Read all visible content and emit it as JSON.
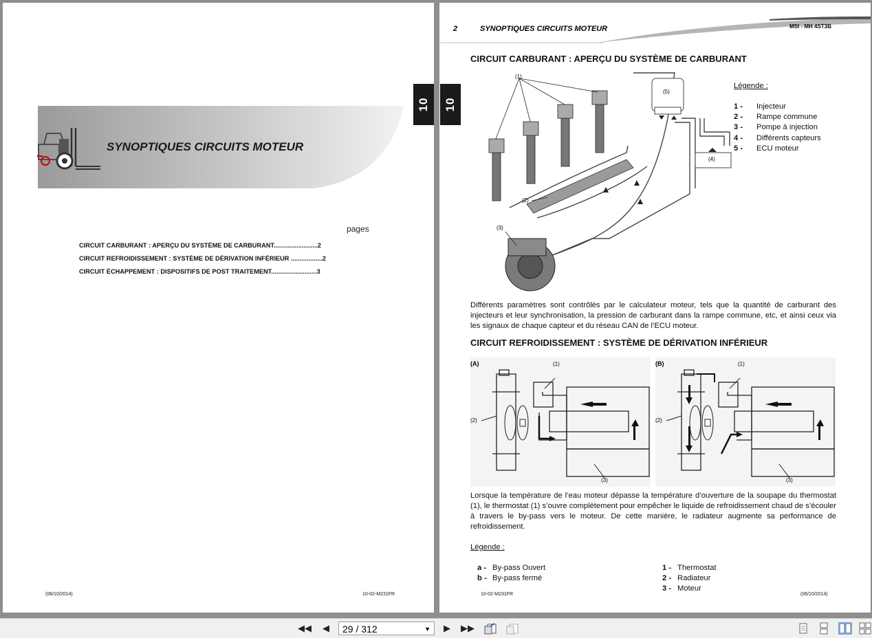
{
  "left_page": {
    "tab_number": "10",
    "cover_title": "SYNOPTIQUES CIRCUITS MOTEUR",
    "pages_label": "pages",
    "toc": [
      {
        "title": "CIRCUIT CARBURANT : APERÇU DU SYSTÈME DE CARBURANT",
        "page": "2"
      },
      {
        "title": "CIRCUIT REFROIDISSEMENT : SYSTÈME DE DÉRIVATION INFÉRIEUR",
        "page": "2"
      },
      {
        "title": "CIRCUIT ÉCHAPPEMENT : DISPOSITIFS DE POST TRAITEMENT",
        "page": "3"
      }
    ],
    "footer_date": "(06/10/2014)",
    "footer_ref": "10-02-M231FR"
  },
  "right_page": {
    "tab_number": "10",
    "header_page": "2",
    "header_title": "SYNOPTIQUES CIRCUITS MOTEUR",
    "header_ref": "MSI - MH 4ST3B",
    "section1_title": "CIRCUIT CARBURANT : APERÇU DU SYSTÈME DE CARBURANT",
    "fuel_legend_head": "Légende :",
    "fuel_legend": [
      {
        "num": "1 -",
        "label": "Injecteur"
      },
      {
        "num": "2 -",
        "label": "Rampe commune"
      },
      {
        "num": "3 -",
        "label": "Pompe à injection"
      },
      {
        "num": "4 -",
        "label": "Différents capteurs"
      },
      {
        "num": "5 -",
        "label": "ECU moteur"
      }
    ],
    "fuel_callouts": {
      "c1": "(1)",
      "c2": "(2)",
      "c3": "(3)",
      "c4": "(4)",
      "c5": "(5)"
    },
    "fuel_paragraph": "Différents paramètres sont contrôlés par le calculateur moteur, tels que la quantité de carburant des injecteurs et leur synchronisation, la pression de carburant dans la rampe commune, etc, et ainsi ceux via les signaux de chaque capteur et du réseau CAN de l’ECU moteur.",
    "section2_title": "CIRCUIT REFROIDISSEMENT : SYSTÈME DE DÉRIVATION INFÉRIEUR",
    "cooling_labels": {
      "a": "(A)",
      "b": "(B)",
      "c1": "(1)",
      "c2": "(2)",
      "c3": "(3)"
    },
    "cooling_paragraph": "Lorsque la température de l’eau moteur dépasse la température d’ouverture de la soupape du thermostat (1), le thermostat (1) s’ouvre complètement pour empêcher le liquide de refroidissement chaud de s’écouler à travers le by-pass vers le moteur. De cette manière, le radiateur augmente sa performance de refroidissement.",
    "cooling_legend_head": "Légende :",
    "cooling_legend_left": [
      {
        "num": "a -",
        "label": "By-pass Ouvert"
      },
      {
        "num": "b -",
        "label": "By-pass fermé"
      }
    ],
    "cooling_legend_right": [
      {
        "num": "1 -",
        "label": "Thermostat"
      },
      {
        "num": "2 -",
        "label": "Radiateur"
      },
      {
        "num": "3 -",
        "label": "Moteur"
      }
    ],
    "footer_ref": "10-02-M231FR",
    "footer_date": "(06/10/2014)"
  },
  "toolbar": {
    "page_indicator": "29 / 312",
    "icons": [
      "first-page-icon",
      "prev-page-icon",
      "next-page-icon",
      "last-page-icon",
      "previous-view-icon",
      "next-view-icon",
      "single-page-view-icon",
      "continuous-view-icon",
      "two-page-view-icon",
      "two-page-continuous-view-icon"
    ]
  }
}
